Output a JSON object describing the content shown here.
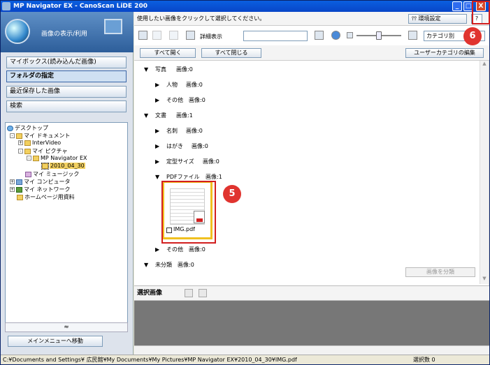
{
  "window": {
    "title": "MP Navigator EX - CanoScan LiDE 200",
    "min": "_",
    "max": "□",
    "close": "X"
  },
  "callouts": {
    "five": "5",
    "six": "6"
  },
  "left": {
    "mode_label": "画像の表示/利用",
    "nav": [
      "マイボックス(読み込んだ画像)",
      "フォルダの指定",
      "最近保存した画像",
      "検索"
    ],
    "tree": {
      "desktop": "デスクトップ",
      "mydocs": "マイ ドキュメント",
      "intervideo": "InterVideo",
      "mypics": "マイ ピクチャ",
      "mpnav": "MP Navigator EX",
      "date": "2010_04_30",
      "mymusic": "マイ ミュージック",
      "mycomputer": "マイ コンピュータ",
      "mynetwork": "マイ ネットワーク",
      "homepage": "ホームページ用資料"
    },
    "collapse": "≈",
    "main_menu": "メインメニューへ移動"
  },
  "right": {
    "instruction": "使用したい画像をクリックして選択してください。",
    "env_settings": "環境設定",
    "help": "?",
    "detail_view": "詳細表示",
    "search_value": "",
    "category_select": "カテゴリ別",
    "open_all": "すべて開く",
    "close_all": "すべて閉じる",
    "edit_user_categories": "ユーザーカテゴリの編集",
    "rows": [
      {
        "tri": "▼",
        "cap": "写真",
        "cnt": "画像:0"
      },
      {
        "tri": "▶",
        "cap": "人物",
        "cnt": "画像:0"
      },
      {
        "tri": "▶",
        "cap": "その他",
        "cnt": "画像:0"
      },
      {
        "tri": "▼",
        "cap": "文書",
        "cnt": "画像:1"
      },
      {
        "tri": "▶",
        "cap": "名刺",
        "cnt": "画像:0"
      },
      {
        "tri": "▶",
        "cap": "はがき",
        "cnt": "画像:0"
      },
      {
        "tri": "▶",
        "cap": "定型サイズ",
        "cnt": "画像:0"
      },
      {
        "tri": "▼",
        "cap": "PDFファイル",
        "cnt": "画像:1"
      },
      {
        "tri": "▶",
        "cap": "その他",
        "cnt": "画像:0"
      },
      {
        "tri": "▼",
        "cap": "未分類",
        "cnt": "画像:0"
      }
    ],
    "thumbnail_name": "IMG.pdf",
    "sort_button": "画像を分類",
    "selected_images": "選択画像"
  },
  "status": {
    "path": "C:¥Documents and Settings¥ 広民館¥My Documents¥My Pictures¥MP Navigator EX¥2010_04_30¥IMG.pdf",
    "selected_count": "選択数 0"
  }
}
